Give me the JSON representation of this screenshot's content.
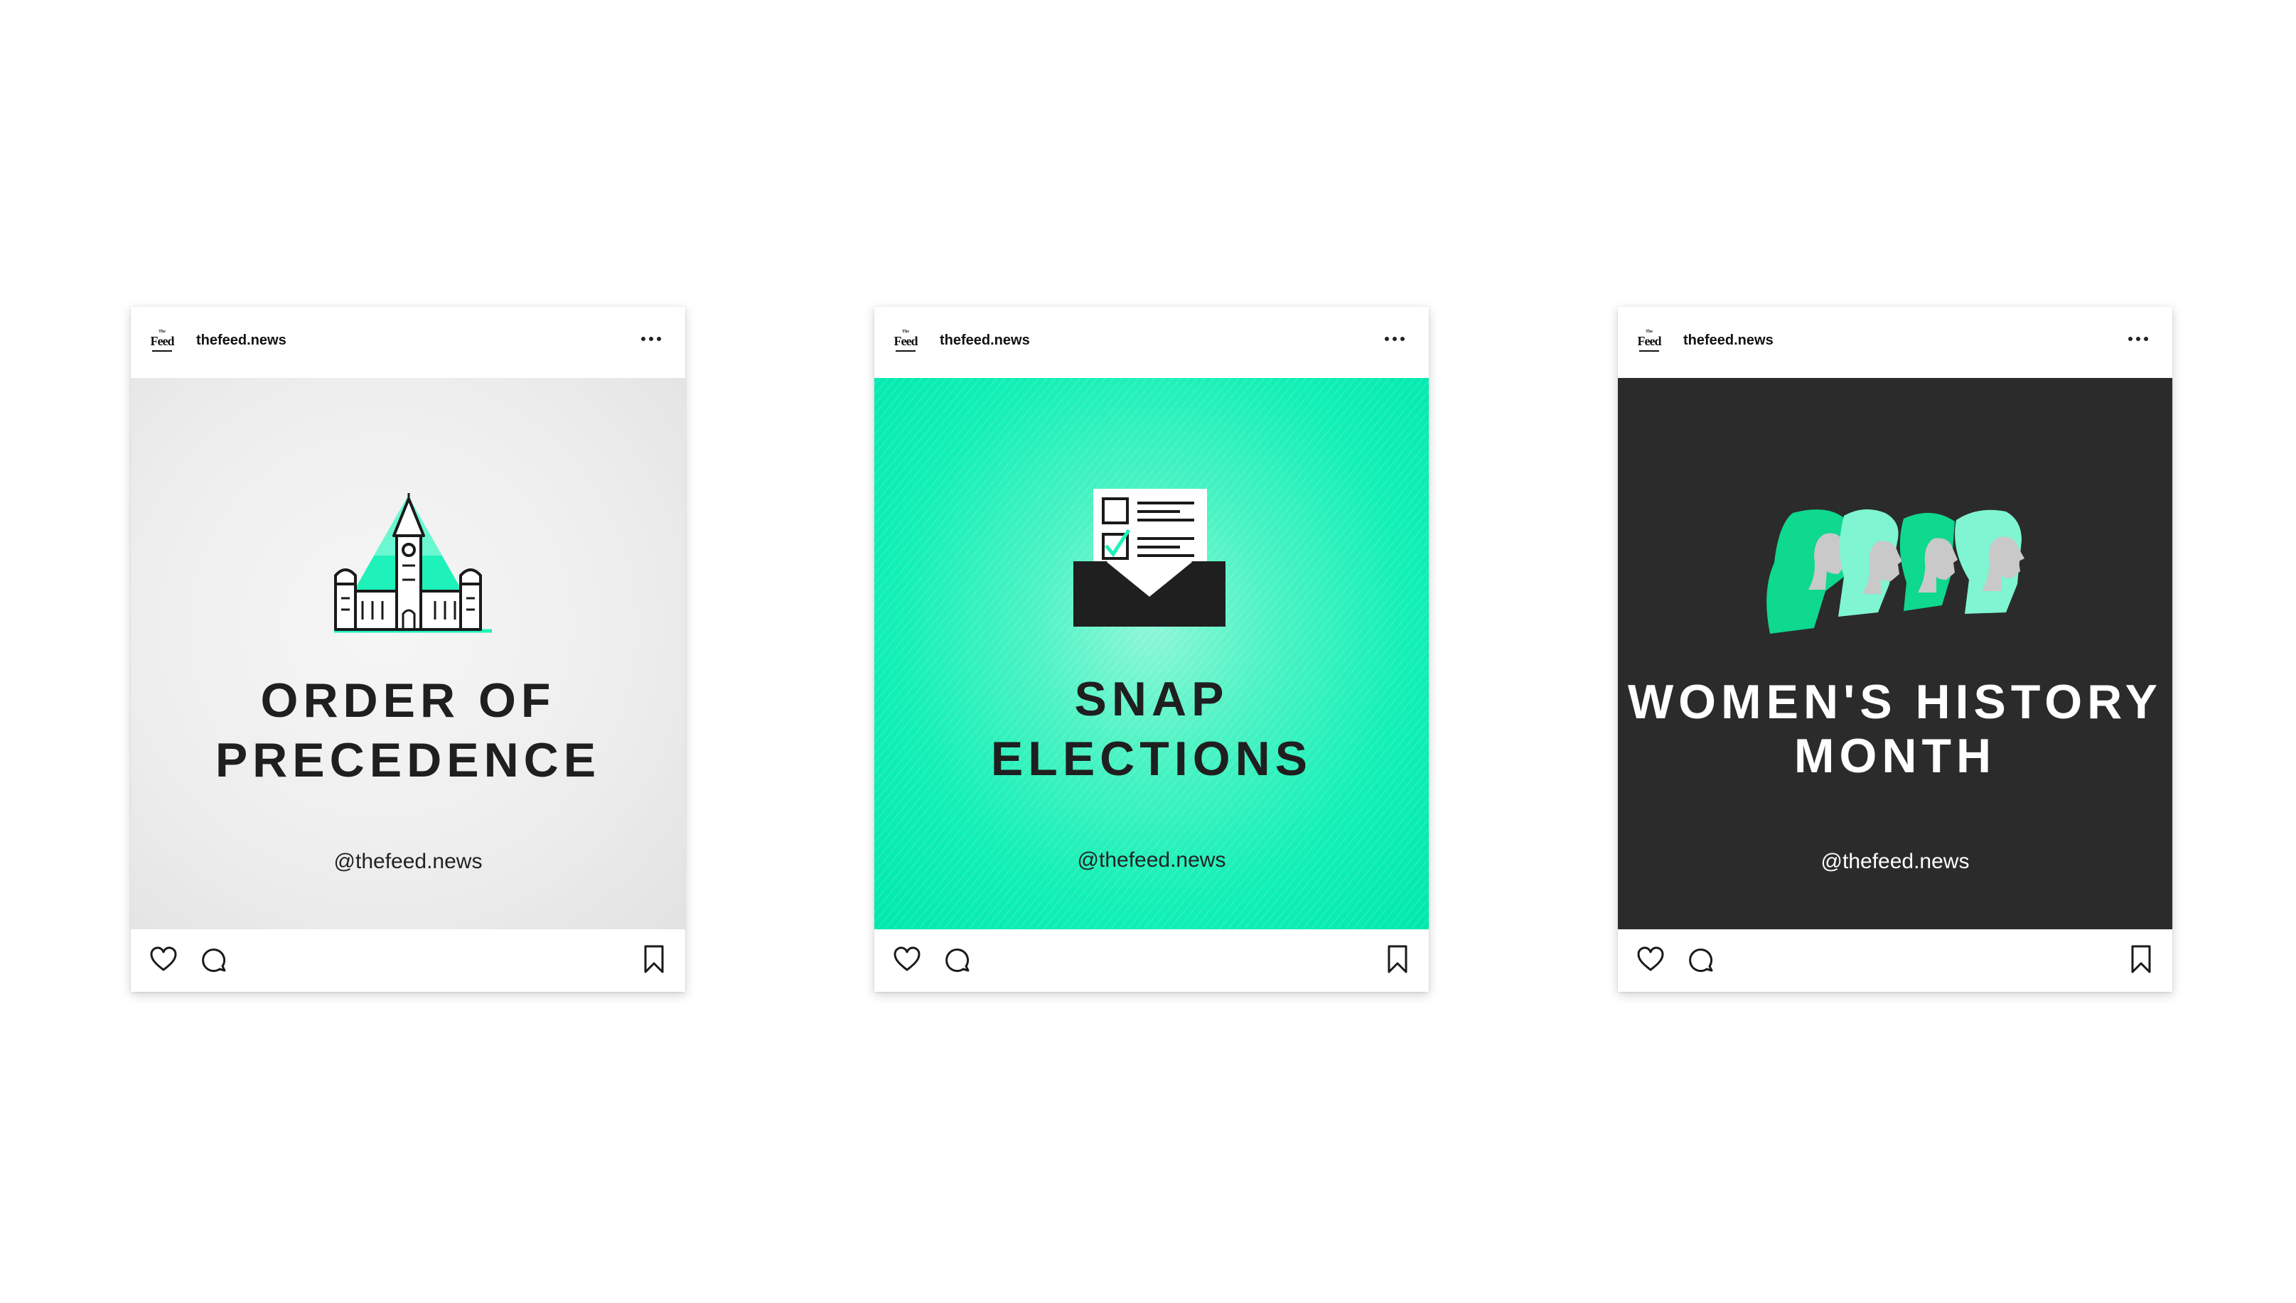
{
  "posts": [
    {
      "avatar": {
        "small": "The",
        "big": "Feed"
      },
      "handle": "thefeed.news",
      "title_lines": [
        "ORDER OF",
        "PRECEDENCE"
      ],
      "tagline": "@thefeed.news",
      "illustration": "parliament-building-icon",
      "background": "#eeeeee"
    },
    {
      "avatar": {
        "small": "The",
        "big": "Feed"
      },
      "handle": "thefeed.news",
      "title_lines": [
        "SNAP",
        "ELECTIONS"
      ],
      "tagline": "@thefeed.news",
      "illustration": "ballot-envelope-icon",
      "background": "#12f0b6"
    },
    {
      "avatar": {
        "small": "The",
        "big": "Feed"
      },
      "handle": "thefeed.news",
      "title_lines": [
        "WOMEN'S HISTORY",
        "MONTH"
      ],
      "tagline": "@thefeed.news",
      "illustration": "women-profiles-icon",
      "background": "#2b2b2b"
    }
  ],
  "icons": {
    "like": "heart-icon",
    "comment": "comment-icon",
    "save": "bookmark-icon",
    "more": "more-options-icon"
  },
  "colors": {
    "accent": "#1ef2ba",
    "dark": "#1f1f1f",
    "light_bg": "#eeeeee"
  }
}
